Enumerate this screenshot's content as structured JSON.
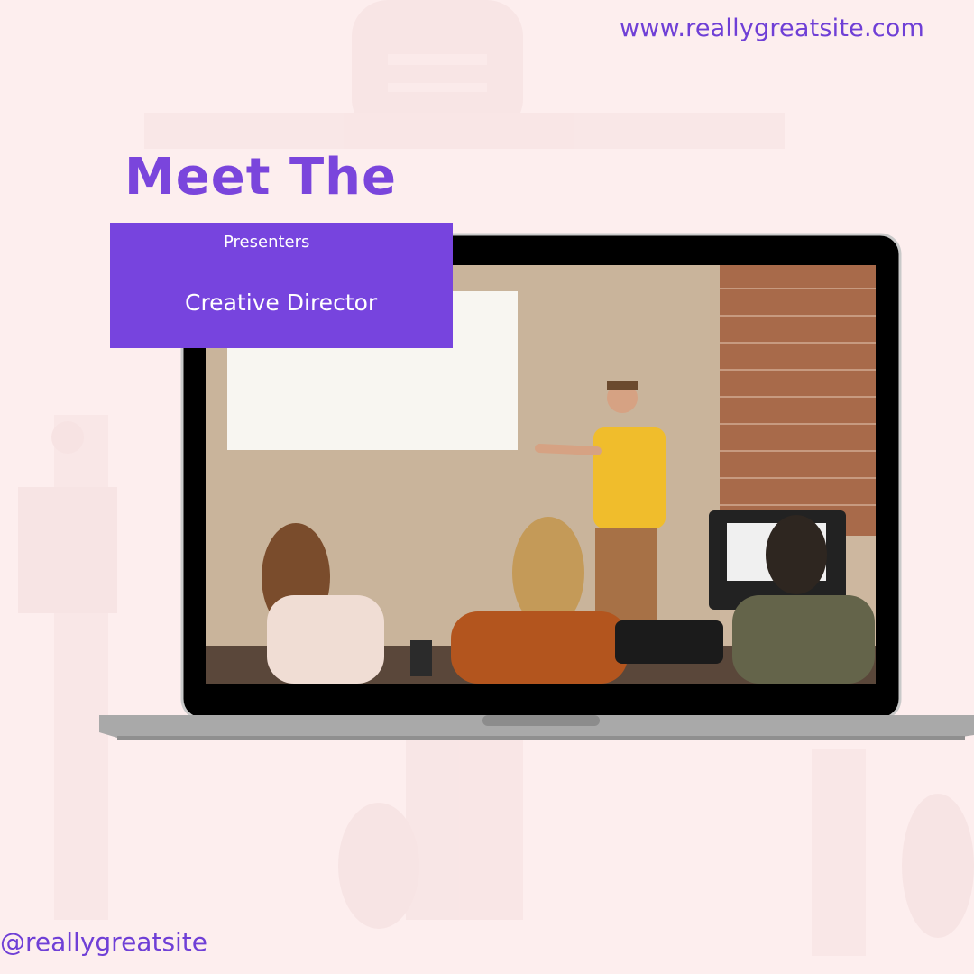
{
  "website": "www.reallygreatsite.com",
  "heading": "Meet The",
  "label": {
    "subtitle": "Presenters",
    "role": "Creative Director"
  },
  "handle": "@reallygreatsite",
  "colors": {
    "background": "#fdeeee",
    "accent": "#7744de",
    "text_accent": "#6f3fd6",
    "laptop_body": "#a8a8a8",
    "screen_bezel": "#000000"
  },
  "image": {
    "description_icon": "presentation-photo-icon"
  }
}
